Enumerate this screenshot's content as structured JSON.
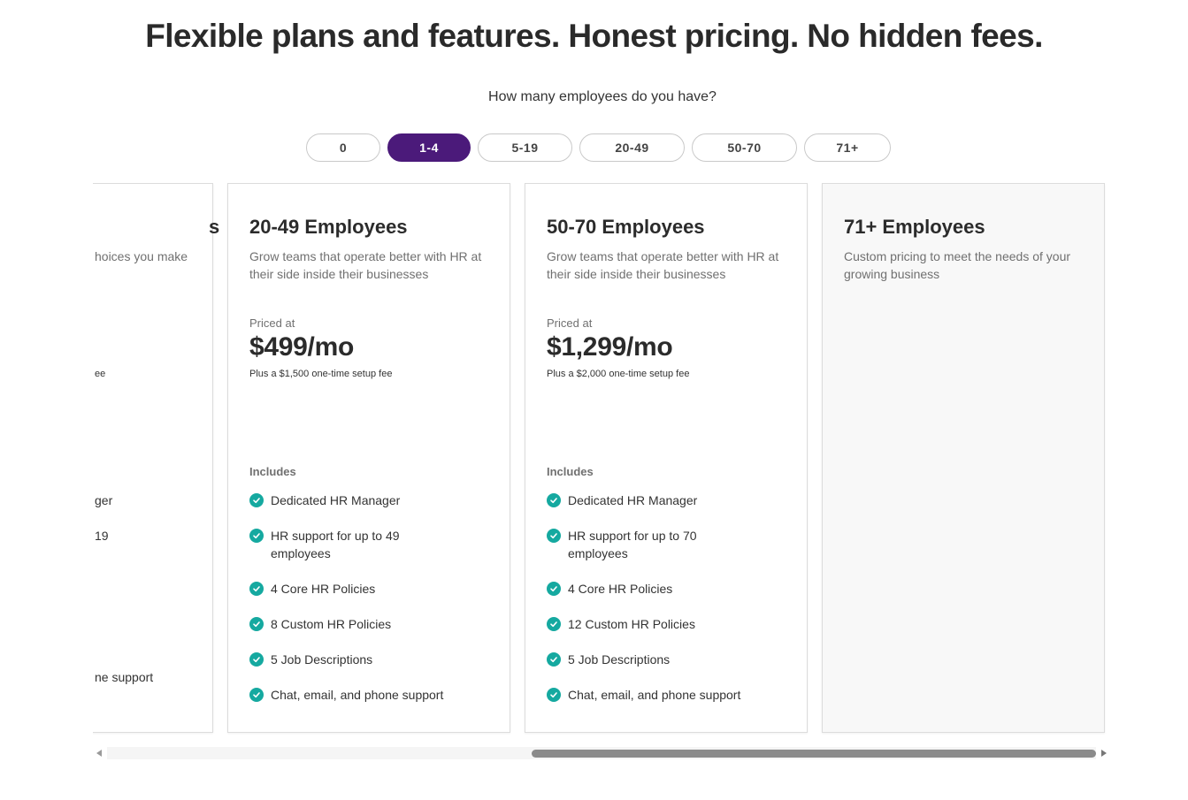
{
  "headline": "Flexible plans and features. Honest pricing. No hidden fees.",
  "question": "How many employees do you have?",
  "employee_options": [
    "0",
    "1-4",
    "5-19",
    "20-49",
    "50-70",
    "71+"
  ],
  "selected_option": "1-4",
  "colors": {
    "accent": "#4b1a7a",
    "check": "#15a9a0",
    "text": "#2b2b2b",
    "muted": "#707070"
  },
  "icons": {
    "feature": "check-circle-icon",
    "scroll_left": "arrow-left-icon",
    "scroll_right": "arrow-right-icon"
  },
  "cards": [
    {
      "title": "s",
      "description": "hoices you make",
      "priced_label": "",
      "price": "",
      "setup_fee": "ee",
      "includes_label": "",
      "features": [
        "ger",
        "19",
        "",
        "",
        "",
        "ne support"
      ]
    },
    {
      "title": "20-49 Employees",
      "description": "Grow teams that operate better with HR at their side inside their businesses",
      "priced_label": "Priced at",
      "price": "$499/mo",
      "setup_fee": "Plus a $1,500 one-time setup fee",
      "includes_label": "Includes",
      "features": [
        "Dedicated HR Manager",
        "HR support for up to 49 employees",
        "4 Core HR Policies",
        "8 Custom HR Policies",
        "5 Job Descriptions",
        "Chat, email, and phone support"
      ]
    },
    {
      "title": "50-70 Employees",
      "description": "Grow teams that operate better with HR at their side inside their businesses",
      "priced_label": "Priced at",
      "price": "$1,299/mo",
      "setup_fee": "Plus a $2,000 one-time setup fee",
      "includes_label": "Includes",
      "features": [
        "Dedicated HR Manager",
        "HR support for up to 70 employees",
        "4 Core HR Policies",
        "12 Custom HR Policies",
        "5 Job Descriptions",
        "Chat, email, and phone support"
      ]
    },
    {
      "title": "71+ Employees",
      "description": "Custom pricing to meet the needs of your growing business",
      "priced_label": "",
      "price": "",
      "setup_fee": "",
      "includes_label": "",
      "features": []
    }
  ]
}
